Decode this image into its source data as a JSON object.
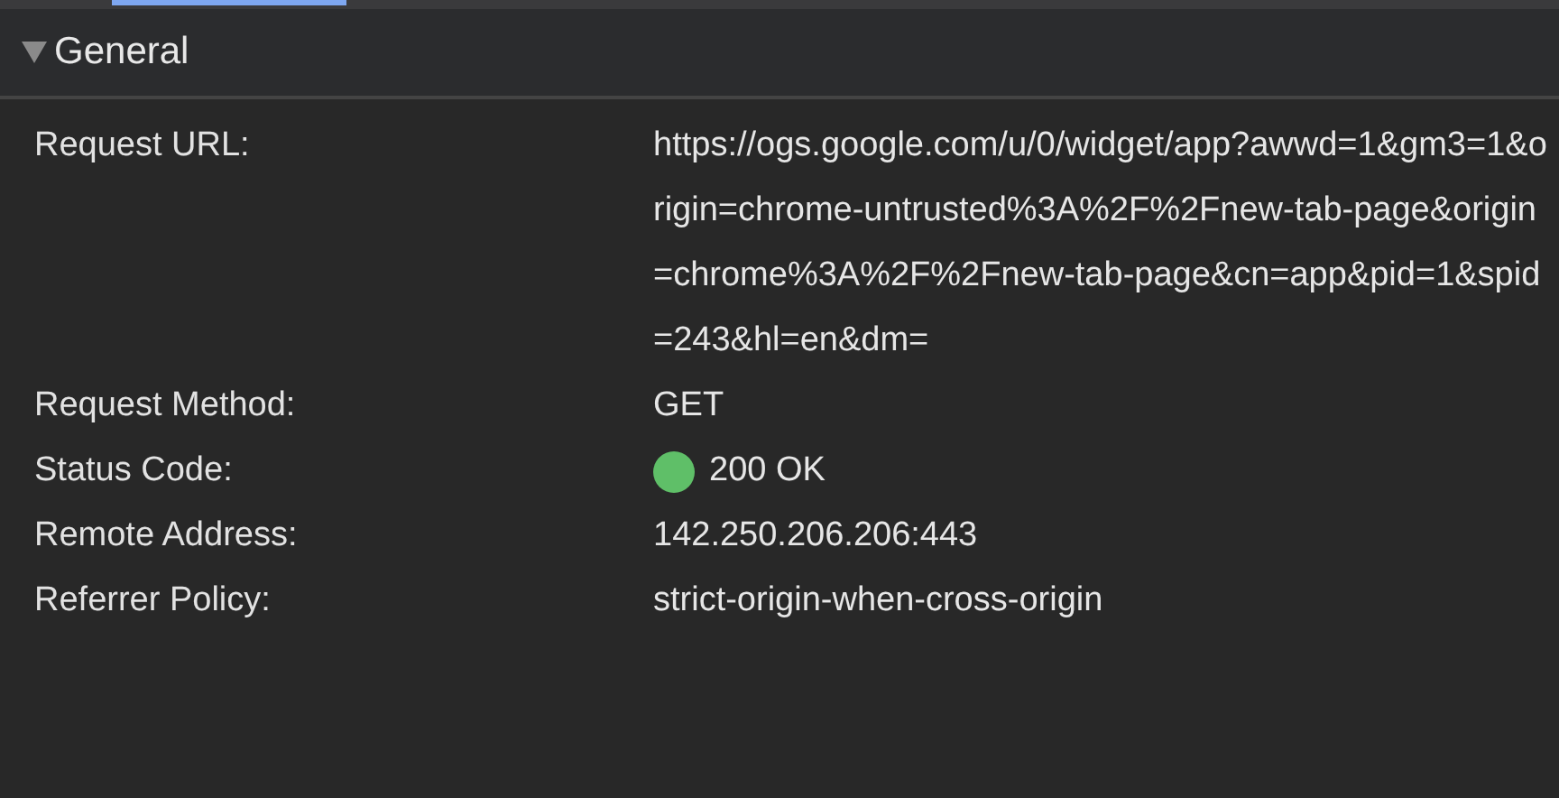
{
  "section": {
    "title": "General",
    "expanded": true,
    "rows": [
      {
        "label": "Request URL:",
        "value": "https://ogs.google.com/u/0/widget/app?awwd=1&gm3=1&origin=chrome-untrusted%3A%2F%2Fnew-tab-page&origin=chrome%3A%2F%2Fnew-tab-page&cn=app&pid=1&spid=243&hl=en&dm="
      },
      {
        "label": "Request Method:",
        "value": "GET"
      },
      {
        "label": "Status Code:",
        "value": "200 OK",
        "color": "#5fbf68"
      },
      {
        "label": "Remote Address:",
        "value": "142.250.206.206:443"
      },
      {
        "label": "Referrer Policy:",
        "value": "strict-origin-when-cross-origin"
      }
    ]
  }
}
